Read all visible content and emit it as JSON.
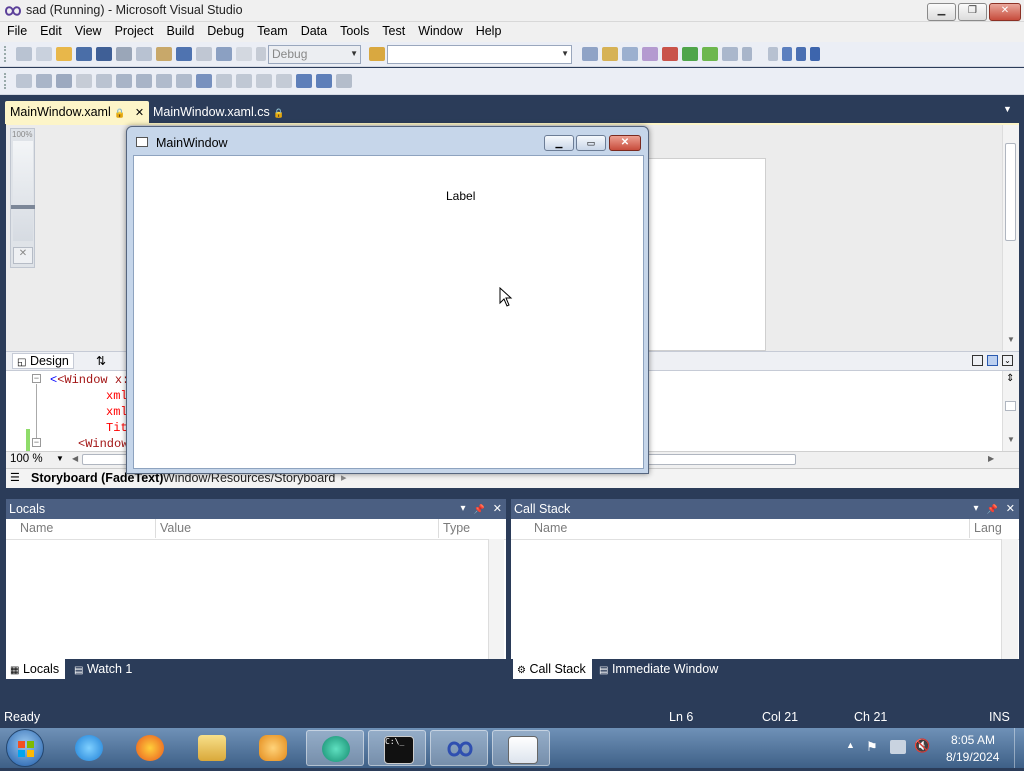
{
  "window": {
    "title": "sad (Running) - Microsoft Visual Studio",
    "min_glyph": "▁",
    "restore_glyph": "❐",
    "close_glyph": "✕"
  },
  "menu": [
    "File",
    "Edit",
    "View",
    "Project",
    "Build",
    "Debug",
    "Team",
    "Data",
    "Tools",
    "Test",
    "Window",
    "Help"
  ],
  "toolbar": {
    "config_value": "Debug",
    "search_value": ""
  },
  "doc_tabs": {
    "active": "MainWindow.xaml",
    "inactive": "MainWindow.xaml.cs",
    "lock_glyph": "🔒",
    "close_glyph": "✕",
    "overflow_glyph": "▼"
  },
  "designer": {
    "zoom_rail_label": "100%"
  },
  "split_bar": {
    "design_tab": "Design",
    "swap_glyph": "⇅"
  },
  "xaml_lines": [
    "<Window x:Cl",
    "xmlr",
    "xmlr",
    "Titl",
    "<Window."
  ],
  "zoom_bar": {
    "zoom": "100 %"
  },
  "breadcrumb": {
    "first": "Storyboard (FadeText)",
    "path": "Window/Resources/Storyboard",
    "arrow": "▸"
  },
  "running_window": {
    "title": "MainWindow",
    "label": "Label"
  },
  "locals_pane": {
    "title": "Locals",
    "columns": [
      "Name",
      "Value",
      "Type"
    ],
    "tabs": [
      "Locals",
      "Watch 1"
    ]
  },
  "callstack_pane": {
    "title": "Call Stack",
    "columns": [
      "Name",
      "Lang"
    ],
    "tabs": [
      "Call Stack",
      "Immediate Window"
    ]
  },
  "pane_glyphs": {
    "dropdown": "▾",
    "pin": "📌",
    "close": "✕"
  },
  "status": {
    "text": "Ready",
    "ln": "Ln 6",
    "col": "Col 21",
    "ch": "Ch 21",
    "mode": "INS"
  },
  "taskbar": {
    "time": "8:05 AM",
    "date": "8/19/2024",
    "apps": [
      "ie-icon",
      "firefox-icon",
      "explorer-icon",
      "media-player-icon",
      "app-icon",
      "cmd-icon",
      "visual-studio-icon",
      "notepad-icon"
    ]
  },
  "colors": {
    "ide_frame": "#2b3c59",
    "active_tab": "#fdf5c8",
    "pane_header": "#4b5f82",
    "close_red": "#c74c3c"
  }
}
